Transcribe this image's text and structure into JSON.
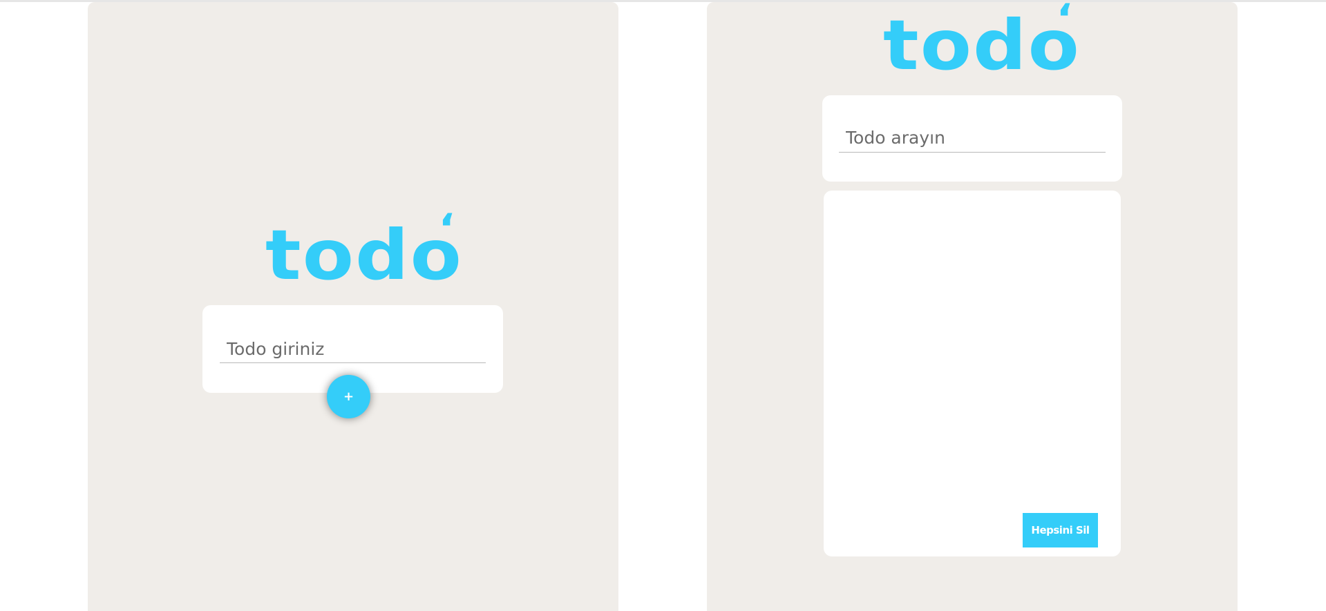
{
  "colors": {
    "accent": "#34cdf9",
    "panel_bg": "#f0ede9",
    "card_bg": "#ffffff",
    "text": "#6b6b6b"
  },
  "left_panel": {
    "logo_text": "todo",
    "logo_mark": "‘",
    "add_input": {
      "placeholder": "Todo giriniz",
      "value": ""
    },
    "add_button": {
      "label": "+",
      "icon": "plus-icon"
    }
  },
  "right_panel": {
    "logo_text": "todo",
    "logo_mark": "‘",
    "search_input": {
      "placeholder": "Todo arayın",
      "value": ""
    },
    "todo_list": [],
    "clear_button": {
      "label": "Hepsini Sil"
    }
  }
}
